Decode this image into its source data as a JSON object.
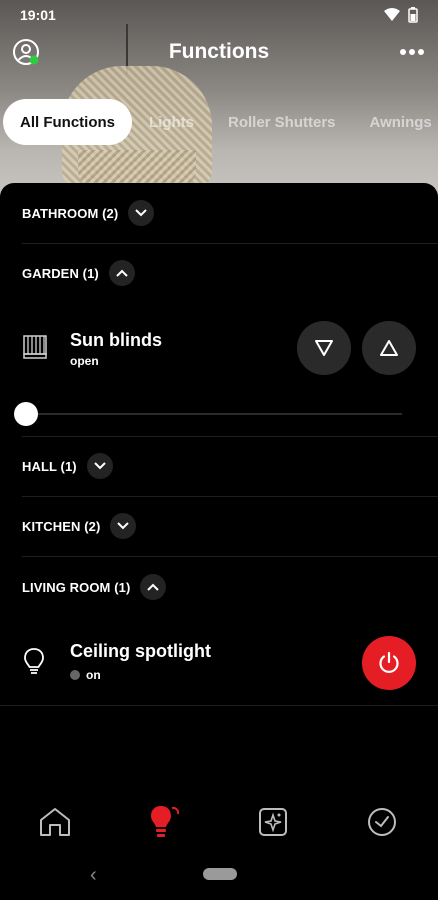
{
  "status": {
    "time": "19:01"
  },
  "header": {
    "title": "Functions"
  },
  "tabs": [
    {
      "label": "All Functions",
      "active": true
    },
    {
      "label": "Lights"
    },
    {
      "label": "Roller Shutters"
    },
    {
      "label": "Awnings"
    }
  ],
  "groups": [
    {
      "label": "BATHROOM (2)",
      "expanded": false
    },
    {
      "label": "GARDEN (1)",
      "expanded": true
    },
    {
      "label": "HALL (1)",
      "expanded": false
    },
    {
      "label": "KITCHEN (2)",
      "expanded": false
    },
    {
      "label": "LIVING ROOM (1)",
      "expanded": true
    }
  ],
  "devices": {
    "sun_blinds": {
      "name": "Sun blinds",
      "state": "open",
      "icon": "blinds-icon",
      "position_percent": 0
    },
    "ceiling_spotlight": {
      "name": "Ceiling spotlight",
      "state": "on",
      "icon": "lightbulb-icon"
    }
  },
  "colors": {
    "accent": "#e51e25",
    "online": "#2ecc40",
    "chip": "#232323"
  },
  "bottom_nav": [
    {
      "icon": "home-icon",
      "active": false
    },
    {
      "icon": "functions-bulb-icon",
      "active": true
    },
    {
      "icon": "scenes-icon",
      "active": false
    },
    {
      "icon": "timer-icon",
      "active": false
    }
  ]
}
